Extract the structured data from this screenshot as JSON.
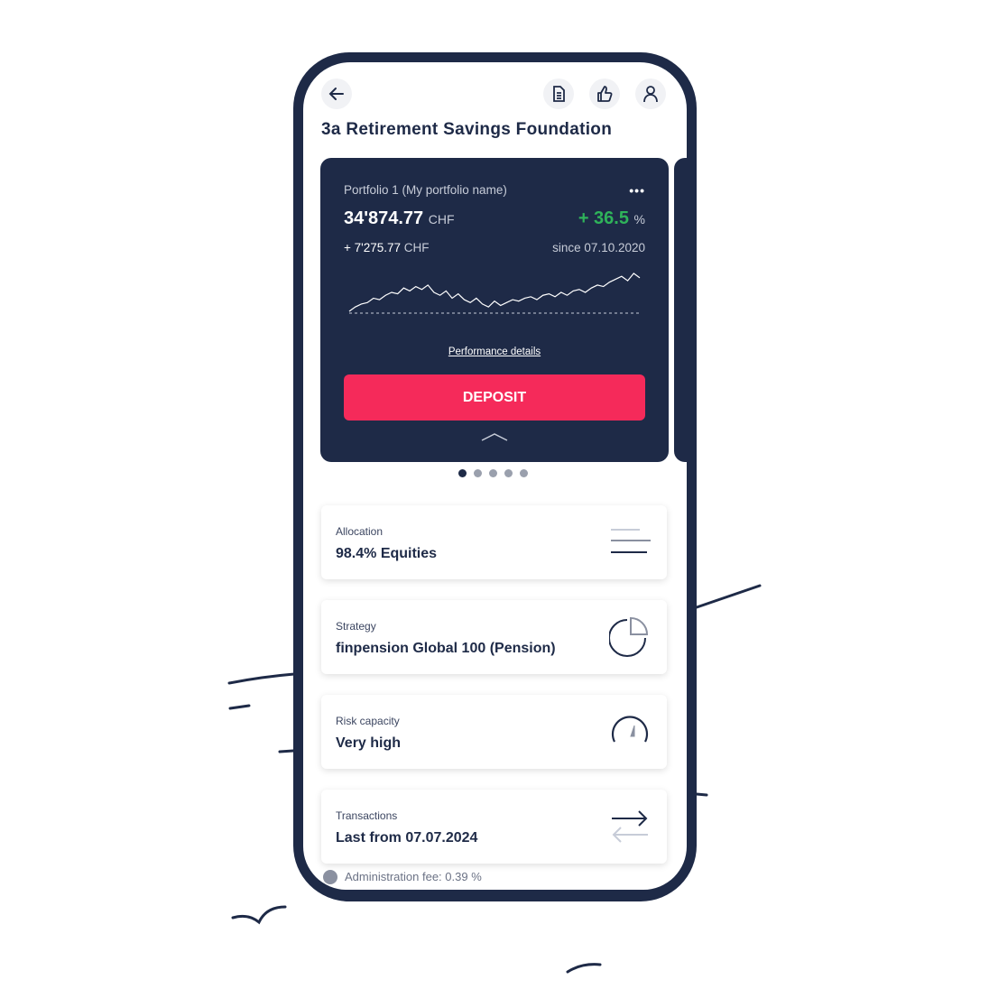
{
  "header": {
    "title": "3a Retirement Savings Foundation"
  },
  "portfolio": {
    "name": "Portfolio 1 (My portfolio name)",
    "value": "34'874.77",
    "currency": "CHF",
    "return_pct": "+ 36.5",
    "pct_unit": "%",
    "gain": "+ 7'275.77",
    "gain_currency": "CHF",
    "since": "since 07.10.2020",
    "performance_link": "Performance details",
    "deposit_label": "DEPOSIT",
    "sparkline": [
      0,
      3,
      5,
      6,
      9,
      8,
      11,
      13,
      12,
      16,
      14,
      17,
      15,
      18,
      13,
      11,
      14,
      9,
      12,
      8,
      6,
      9,
      5,
      3,
      7,
      4,
      6,
      8,
      7,
      9,
      10,
      8,
      11,
      12,
      10,
      13,
      11,
      14,
      15,
      13,
      16,
      18,
      17,
      20,
      22,
      24,
      21,
      26,
      23
    ],
    "pages": 5,
    "active_page": 0,
    "accent_color": "#f52a5a",
    "gain_color": "#2fb35a"
  },
  "items": [
    {
      "label": "Allocation",
      "value": "98.4% Equities",
      "icon": "menu-lines-icon"
    },
    {
      "label": "Strategy",
      "value": "finpension Global 100 (Pension)",
      "icon": "pie-chart-icon"
    },
    {
      "label": "Risk capacity",
      "value": "Very high",
      "icon": "gauge-icon"
    },
    {
      "label": "Transactions",
      "value": "Last from 07.07.2024",
      "icon": "transfer-arrows-icon"
    }
  ],
  "footer": {
    "admin_fee": "Administration fee: 0.39 %"
  }
}
